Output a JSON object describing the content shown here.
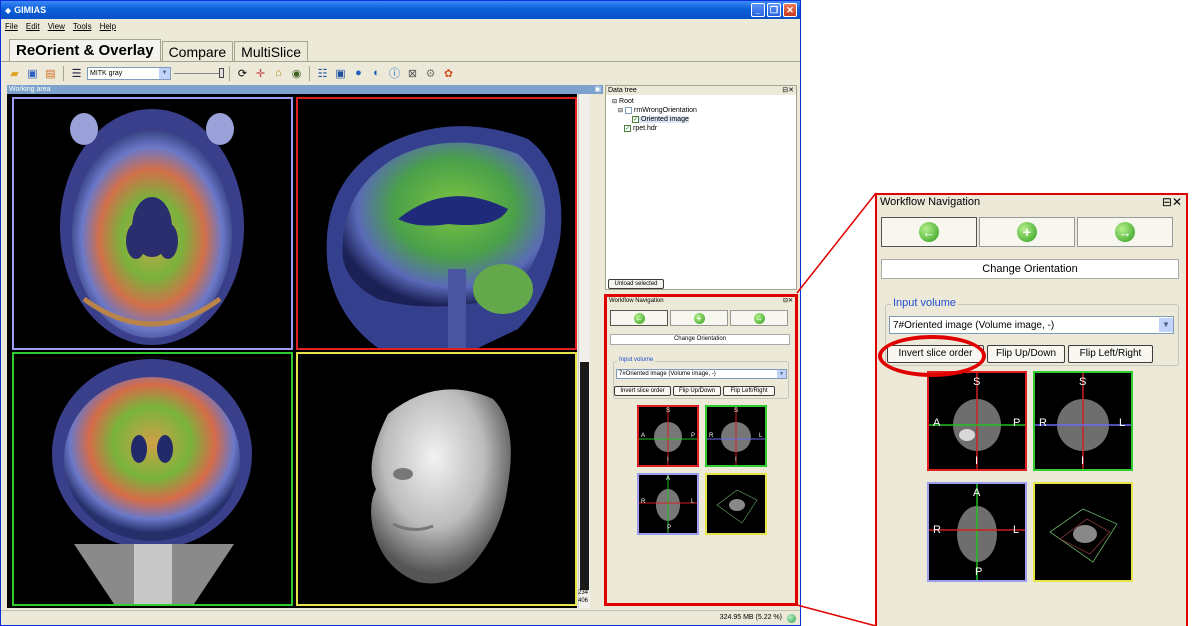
{
  "app": {
    "title": "GIMIAS",
    "menu": [
      "File",
      "Edit",
      "View",
      "Tools",
      "Help"
    ],
    "tabs": [
      "ReOrient & Overlay",
      "Compare",
      "MultiSlice"
    ],
    "active_tab": 0,
    "toolbar": {
      "lut_value": "MITK gray"
    },
    "working_area_label": "Working area",
    "coords": [
      "234",
      "406"
    ],
    "status_memory": "324.95 MB (5.22 %)"
  },
  "data_tree": {
    "title": "Data tree",
    "nodes": [
      {
        "label": "Root",
        "checked": null
      },
      {
        "label": "rmWrongOrientation",
        "checked": false
      },
      {
        "label": "Oriented image",
        "checked": true
      },
      {
        "label": "rpet.hdr",
        "checked": true
      }
    ],
    "unload_button": "Unload selected"
  },
  "workflow": {
    "title": "Workflow Navigation",
    "step_label": "Change Orientation",
    "input_volume_legend": "Input volume",
    "input_volume_value": "7#Oriented image (Volume image, -)",
    "buttons": {
      "invert": "Invert slice order",
      "flip_ud": "Flip Up/Down",
      "flip_lr": "Flip Left/Right"
    },
    "thumb_labels": {
      "sagittal": {
        "top": "S",
        "left": "A",
        "right": "P",
        "bottom": "I"
      },
      "coronal": {
        "top": "S",
        "left": "R",
        "right": "L",
        "bottom": "I"
      },
      "axial": {
        "top": "A",
        "left": "R",
        "right": "L",
        "bottom": "P"
      }
    }
  },
  "colors": {
    "highlight": "#e00000",
    "vp_axial": "#9c9cf0",
    "vp_sagittal": "#e02020",
    "vp_coronal": "#2ecc2e",
    "vp_3d": "#e6e24c"
  }
}
